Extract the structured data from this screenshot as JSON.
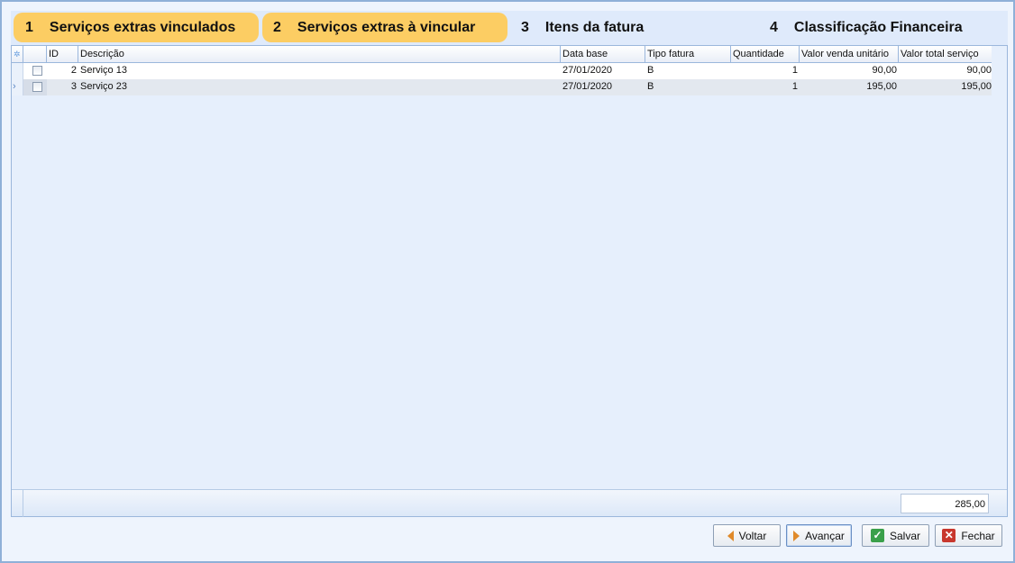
{
  "steps": [
    {
      "num": "1",
      "label": "Serviços extras vinculados",
      "active": true
    },
    {
      "num": "2",
      "label": "Serviços extras à vincular",
      "active": true
    },
    {
      "num": "3",
      "label": "Itens da fatura",
      "active": false
    },
    {
      "num": "4",
      "label": "Classificação Financeira",
      "active": false
    }
  ],
  "grid": {
    "corner_icon": "✲",
    "headers": {
      "id": "ID",
      "descricao": "Descrição",
      "data_base": "Data base",
      "tipo_fatura": "Tipo fatura",
      "quantidade": "Quantidade",
      "valor_unitario": "Valor venda unitário",
      "valor_total": "Valor total serviço"
    },
    "rows": [
      {
        "id": "2",
        "descricao": "Serviço 13",
        "data_base": "27/01/2020",
        "tipo_fatura": "B",
        "quantidade": "1",
        "valor_unitario": "90,00",
        "valor_total": "90,00",
        "checked": false
      },
      {
        "id": "3",
        "descricao": "Serviço 23",
        "data_base": "27/01/2020",
        "tipo_fatura": "B",
        "quantidade": "1",
        "valor_unitario": "195,00",
        "valor_total": "195,00",
        "checked": false
      }
    ],
    "current_row_indicator": "›",
    "total": "285,00"
  },
  "buttons": {
    "voltar": "Voltar",
    "avancar": "Avançar",
    "salvar": "Salvar",
    "fechar": "Fechar"
  },
  "icons": {
    "voltar": "arrow-left-icon",
    "avancar": "arrow-right-icon",
    "salvar": "check-icon",
    "fechar": "close-icon"
  },
  "colors": {
    "active_step": "#fccd63",
    "window_border": "#8fb0d8"
  }
}
